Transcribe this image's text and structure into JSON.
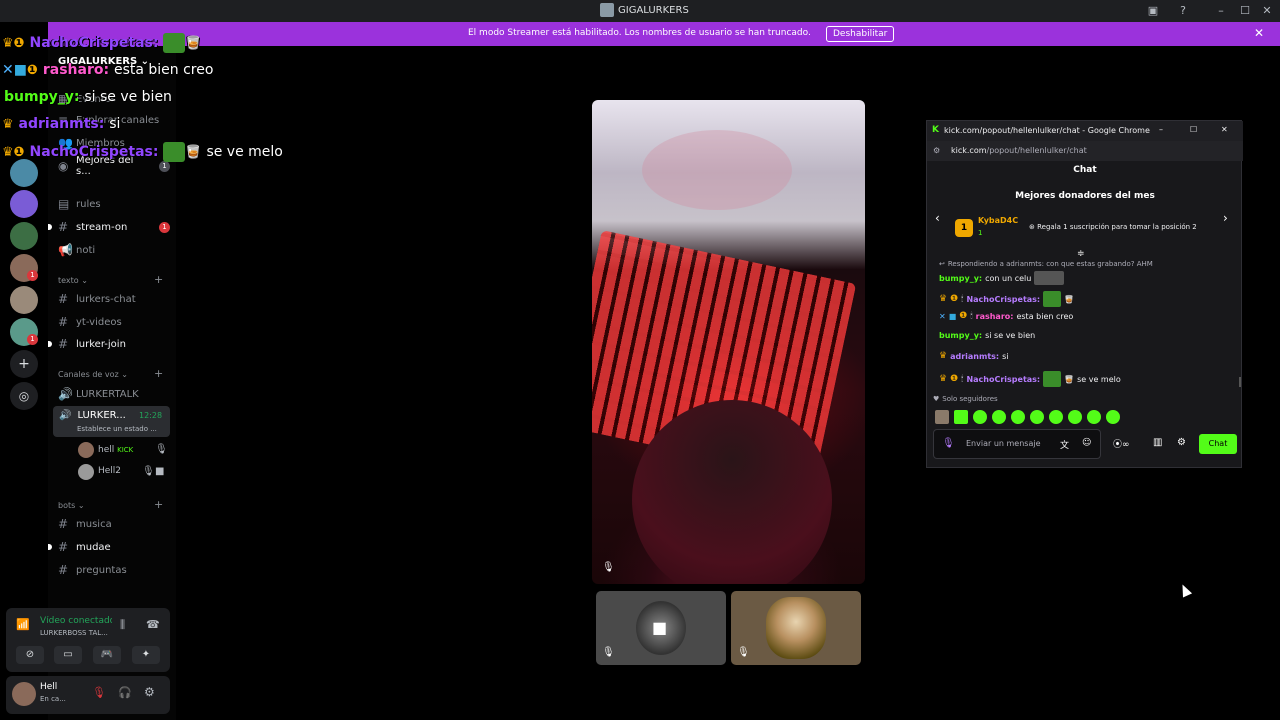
{
  "window": {
    "title": "GIGALURKERS"
  },
  "banner": {
    "message": "El modo Streamer está habilitado. Los nombres de usuario se han truncado.",
    "button": "Deshabilitar"
  },
  "sidebar": {
    "guild_name": "GIGALURKERS",
    "top_items": [
      "Eventos",
      "Explorar canales",
      "Miembros"
    ],
    "mejores": {
      "label": "Mejores del s...",
      "count": "1"
    },
    "channels_top": [
      {
        "name": "rules",
        "unread": false
      },
      {
        "name": "stream-on",
        "unread": true,
        "count": "1"
      },
      {
        "name": "noti",
        "unread": false
      }
    ],
    "category_texto": "texto",
    "channels_texto": [
      {
        "name": "lurkers-chat",
        "unread": false
      },
      {
        "name": "yt-videos",
        "unread": false
      },
      {
        "name": "lurker-join",
        "unread": true
      }
    ],
    "category_voz": "Canales de voz",
    "voice_channels": [
      {
        "name": "LURKERTALK"
      },
      {
        "name": "LURKER...",
        "time": "12:28",
        "status": "Establece un estado ..."
      }
    ],
    "voice_users": [
      {
        "name": "hell",
        "tag": "KICK"
      },
      {
        "name": "Hell2"
      }
    ],
    "category_bots": "bots",
    "channels_bots": [
      {
        "name": "musica",
        "unread": false
      },
      {
        "name": "mudae",
        "unread": true
      },
      {
        "name": "preguntas",
        "unread": false
      }
    ]
  },
  "voice_panel": {
    "status": "Vídeo conectado",
    "channel": "LURKERBOSS TAL..."
  },
  "user_panel": {
    "name": "Hell",
    "status": "En ca..."
  },
  "overlay_chat": [
    {
      "user": "NachoCrispetas:",
      "text": ""
    },
    {
      "user": "rasharo:",
      "text": "esta bien creo"
    },
    {
      "user": "bumpy_y:",
      "text": "si se ve bien"
    },
    {
      "user": "adrianmts:",
      "text": "si"
    },
    {
      "user": "NachoCrispetas:",
      "text": "se ve melo"
    }
  ],
  "popup": {
    "title": "kick.com/popout/hellenlulker/chat - Google Chrome",
    "url_host": "kick.com",
    "url_path": "/popout/hellenlulker/chat",
    "header": "Chat",
    "donors_title": "Mejores donadores del mes",
    "top_donor": "KybaD4C",
    "top_donor_count": "1",
    "gift_text": "Regala 1 suscripción para tomar la posición 2",
    "reply_text": "Respondiendo a adrianmts: con que estas grabando? AHM",
    "messages": [
      {
        "user": "bumpy_y:",
        "text": "con un celu",
        "color": "green"
      },
      {
        "user": "NachoCrispetas:",
        "text": "",
        "color": "purple"
      },
      {
        "user": "rasharo:",
        "text": "esta bien creo",
        "color": "pink"
      },
      {
        "user": "bumpy_y:",
        "text": "si se ve bien",
        "color": "green"
      },
      {
        "user": "adrianmts:",
        "text": "si",
        "color": "purple"
      },
      {
        "user": "NachoCrispetas:",
        "text": "se ve melo",
        "color": "purple"
      }
    ],
    "followers_only": "Solo seguidores",
    "input_placeholder": "Enviar un mensaje",
    "send_button": "Chat"
  },
  "colors": {
    "banner": "#9b32dc",
    "kick_green": "#53fc18",
    "discord_bg": "#000000"
  }
}
